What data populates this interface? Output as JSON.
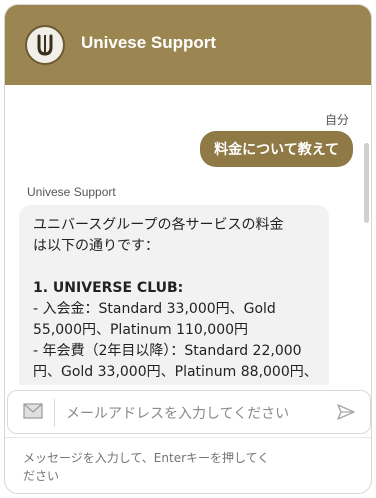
{
  "header": {
    "title": "Univese Support",
    "avatar_letter": "U"
  },
  "conversation": {
    "user_label": "自分",
    "user_message": "料金について教えて",
    "bot_label": "Univese Support",
    "bot_lines": [
      "ユニバースグループの各サービスの料金",
      "は以下の通りです：",
      "",
      "1. UNIVERSE CLUB:",
      "- 入会金：Standard 33,000円、Gold",
      "55,000円、Platinum 110,000円",
      "- 年会費（2年目以降）：Standard 22,000",
      "円、Gold 33,000円、Platinum 88,000円、"
    ]
  },
  "email_field": {
    "placeholder": "メールアドレスを入力してください",
    "icon": "mail-icon",
    "send_icon": "send-icon"
  },
  "message_field": {
    "placeholder": "メッセージを入力して、Enterキーを押してください"
  },
  "colors": {
    "brand": "#9b8551",
    "bubble_user": "#8f7a46",
    "bubble_bot": "#f2f2f2"
  }
}
